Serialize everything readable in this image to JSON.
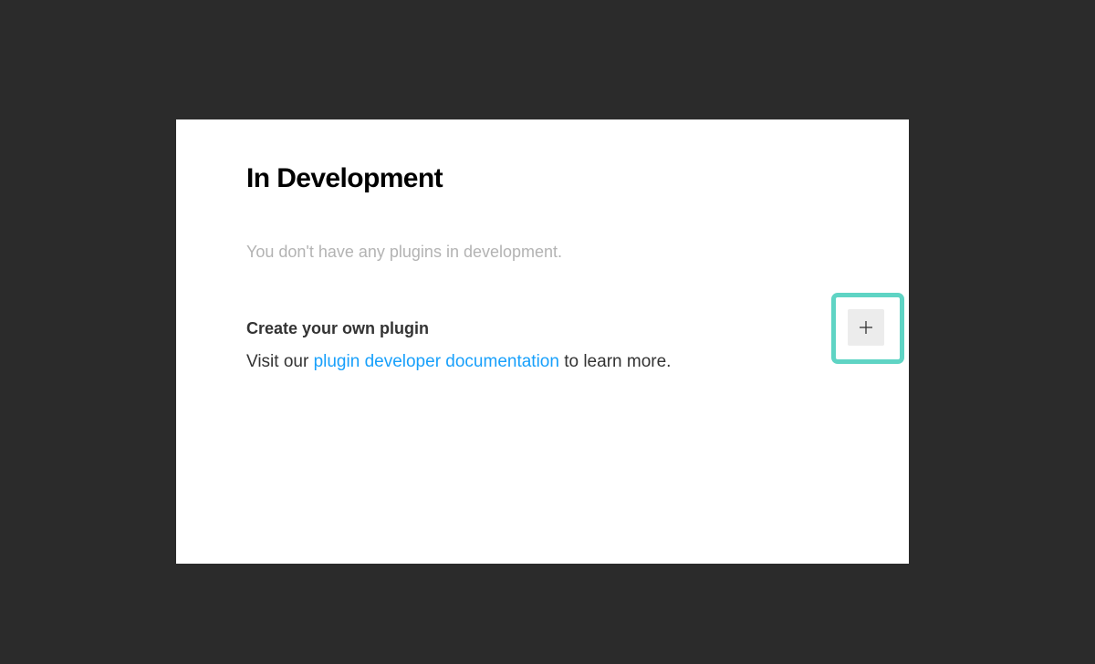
{
  "page": {
    "title": "In Development",
    "empty_message": "You don't have any plugins in development."
  },
  "create_section": {
    "heading": "Create your own plugin",
    "text_before_link": "Visit our ",
    "link_text": "plugin developer documentation",
    "text_after_link": " to learn more."
  },
  "add_button": {
    "icon": "plus-icon",
    "highlight_color": "#5fd4c4"
  },
  "colors": {
    "backdrop": "#2b2b2b",
    "panel": "#ffffff",
    "link": "#18a0fb",
    "muted_text": "#b3b3b3"
  }
}
